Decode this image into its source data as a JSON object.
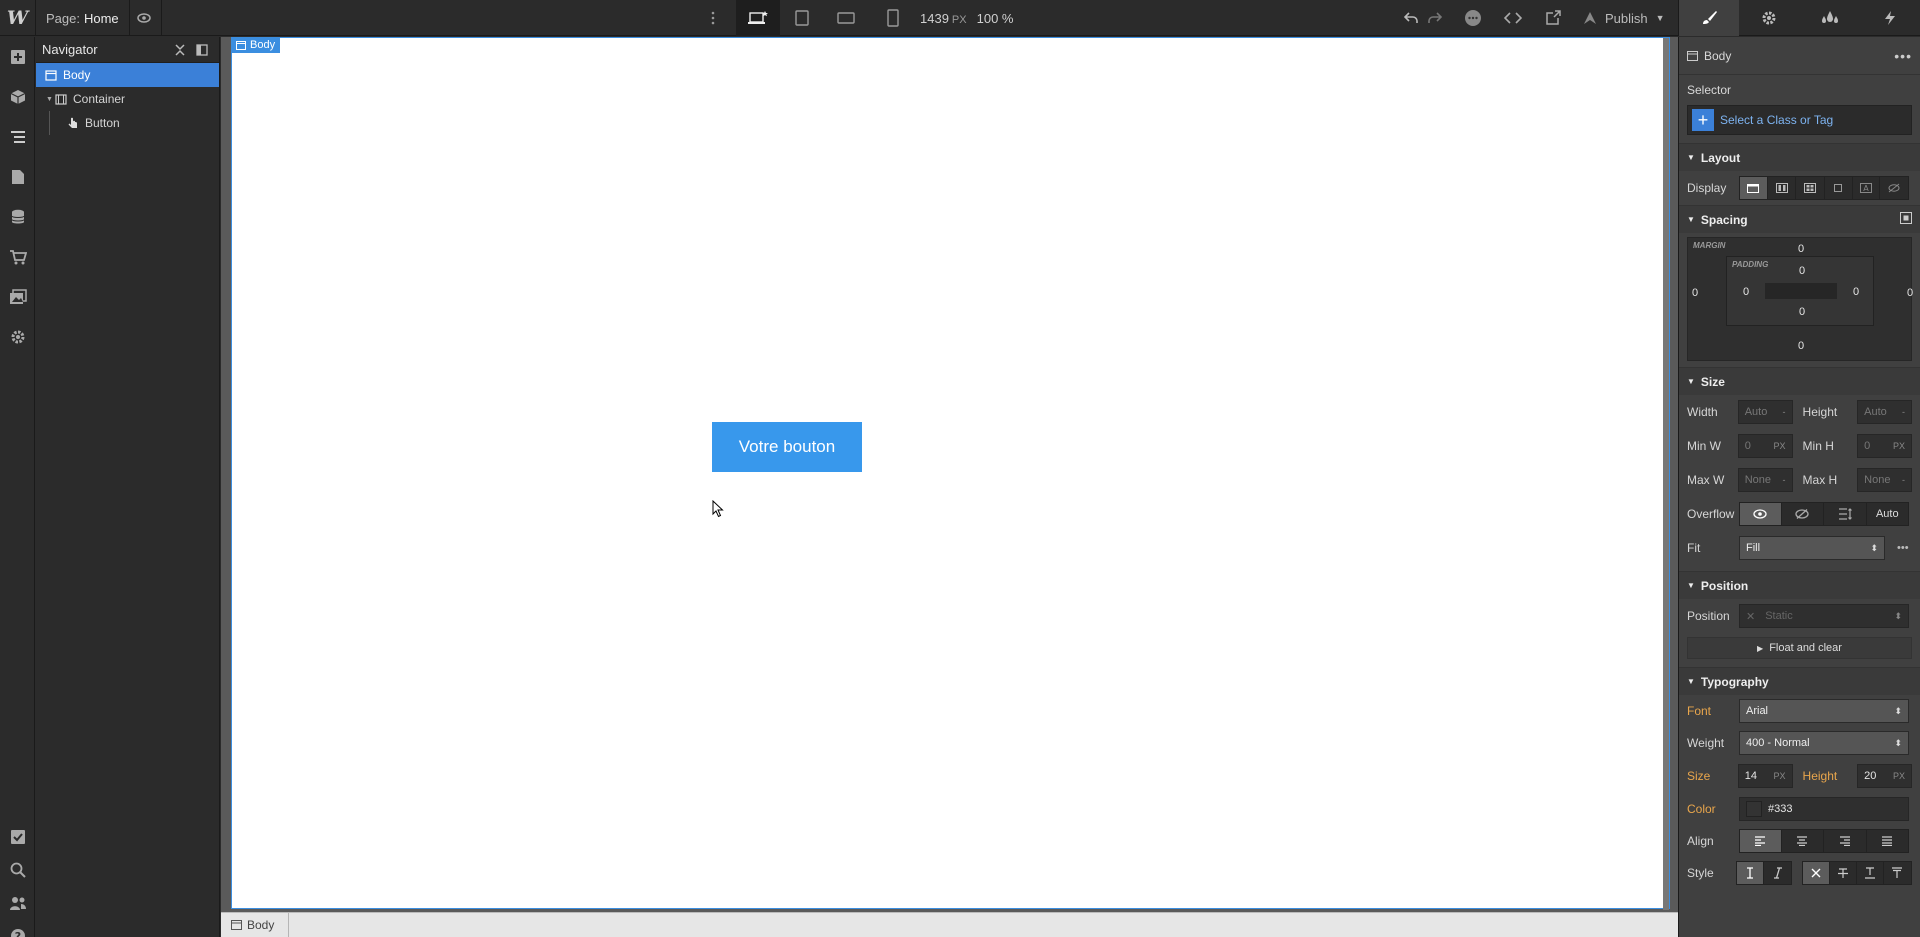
{
  "topbar": {
    "logo": "W",
    "page_label": "Page:",
    "page_name": "Home",
    "canvas_width": "1439",
    "canvas_width_unit": "PX",
    "zoom": "100 %",
    "publish_label": "Publish"
  },
  "navigator": {
    "title": "Navigator",
    "items": [
      {
        "label": "Body",
        "selected": true
      },
      {
        "label": "Container",
        "selected": false
      },
      {
        "label": "Button",
        "selected": false
      }
    ]
  },
  "canvas": {
    "body_tag": "Body",
    "button_text": "Votre bouton",
    "breadcrumb": "Body"
  },
  "panel": {
    "element": "Body",
    "selector_label": "Selector",
    "selector_placeholder": "Select a Class or Tag",
    "layout": {
      "title": "Layout",
      "display_label": "Display"
    },
    "spacing": {
      "title": "Spacing",
      "margin_label": "MARGIN",
      "padding_label": "PADDING",
      "margin": {
        "top": "0",
        "right": "0",
        "bottom": "0",
        "left": "0"
      },
      "padding": {
        "top": "0",
        "right": "0",
        "bottom": "0",
        "left": "0"
      }
    },
    "size": {
      "title": "Size",
      "width_label": "Width",
      "width": "Auto",
      "width_unit": "-",
      "height_label": "Height",
      "height": "Auto",
      "height_unit": "-",
      "min_w_label": "Min W",
      "min_w": "0",
      "min_w_unit": "PX",
      "min_h_label": "Min H",
      "min_h": "0",
      "min_h_unit": "PX",
      "max_w_label": "Max W",
      "max_w": "None",
      "max_w_unit": "-",
      "max_h_label": "Max H",
      "max_h": "None",
      "max_h_unit": "-",
      "overflow_label": "Overflow",
      "overflow_auto": "Auto",
      "fit_label": "Fit",
      "fit": "Fill"
    },
    "position": {
      "title": "Position",
      "label": "Position",
      "value": "Static",
      "float_label": "Float and clear"
    },
    "typography": {
      "title": "Typography",
      "font_label": "Font",
      "font": "Arial",
      "weight_label": "Weight",
      "weight": "400 - Normal",
      "size_label": "Size",
      "size": "14",
      "size_unit": "PX",
      "height_label": "Height",
      "line_height": "20",
      "line_height_unit": "PX",
      "color_label": "Color",
      "color": "#333",
      "align_label": "Align",
      "style_label": "Style"
    }
  },
  "colors": {
    "accent": "#3b80d8",
    "button": "#3898ec",
    "orange_label": "#e9a64c"
  }
}
